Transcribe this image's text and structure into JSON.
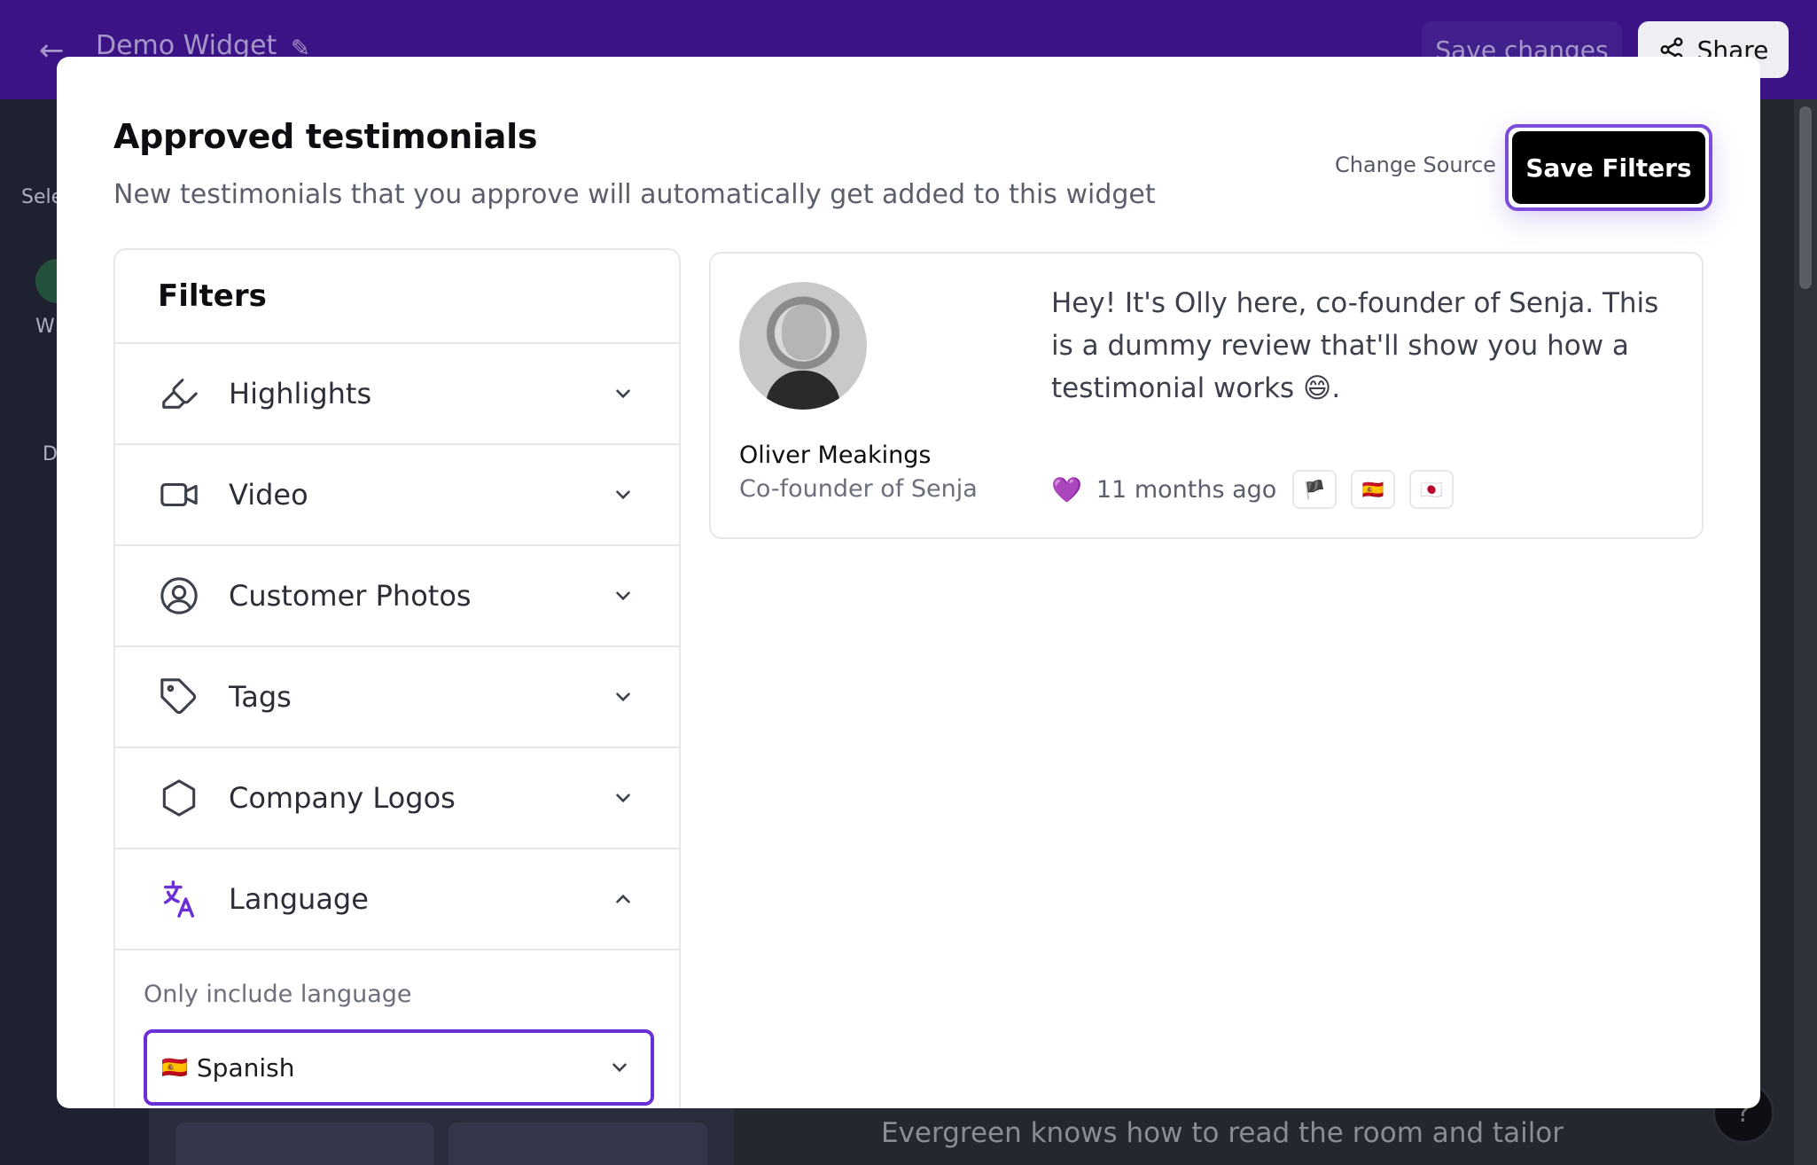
{
  "app": {
    "title": "Demo Widget",
    "save_changes_label": "Save changes",
    "share_label": "Share",
    "rail_select": "Sele",
    "rail_w": "W",
    "rail_d": "D",
    "canvas_text": "Evergreen knows how to read the room and tailor messages"
  },
  "modal": {
    "title": "Approved testimonials",
    "subtitle": "New testimonials that you approve will automatically get added to this widget",
    "change_source_label": "Change Source",
    "save_filters_label": "Save Filters"
  },
  "filters": {
    "title": "Filters",
    "items": [
      {
        "label": "Highlights",
        "icon": "highlighter-icon",
        "expanded": false
      },
      {
        "label": "Video",
        "icon": "video-icon",
        "expanded": false
      },
      {
        "label": "Customer Photos",
        "icon": "user-circle-icon",
        "expanded": false
      },
      {
        "label": "Tags",
        "icon": "tag-icon",
        "expanded": false
      },
      {
        "label": "Company Logos",
        "icon": "hexagon-icon",
        "expanded": false
      },
      {
        "label": "Language",
        "icon": "translate-icon",
        "expanded": true
      }
    ],
    "language": {
      "caption": "Only include language",
      "selected_flag": "🇪🇸",
      "selected_value": "Spanish"
    }
  },
  "review": {
    "text": "Hey! It's Olly here, co-founder of Senja. This is a dummy review that'll show you how a testimonial works 😄.",
    "name": "Oliver Meakings",
    "role": "Co-founder of Senja",
    "heart": "💜",
    "time_ago": "11 months ago",
    "flags": [
      "🏴",
      "🇪🇸",
      "🇯🇵"
    ]
  },
  "colors": {
    "brand_purple": "#3a1485",
    "accent_purple": "#6b2fd6",
    "button_black": "#000000"
  }
}
